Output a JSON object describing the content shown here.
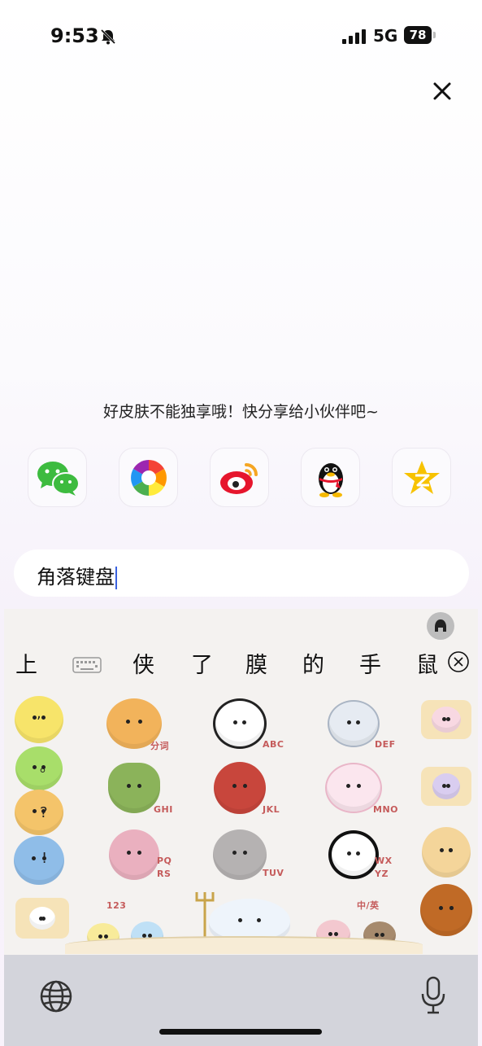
{
  "status_bar": {
    "time": "9:53",
    "network": "5G",
    "battery": "78"
  },
  "share": {
    "prompt": "好皮肤不能独享哦！快分享给小伙伴吧~",
    "targets": [
      {
        "name": "wechat",
        "icon": "wechat-icon"
      },
      {
        "name": "moments",
        "icon": "moments-aperture-icon"
      },
      {
        "name": "weibo",
        "icon": "weibo-icon"
      },
      {
        "name": "qq",
        "icon": "qq-penguin-icon"
      },
      {
        "name": "qzone",
        "icon": "qzone-star-icon"
      }
    ]
  },
  "input": {
    "value": "角落键盘"
  },
  "candidates": [
    "上",
    "侠",
    "了",
    "膜",
    "的",
    "手",
    "鼠"
  ],
  "keyboard": {
    "punct": [
      ",",
      "。",
      "?",
      "!"
    ],
    "keys": [
      {
        "label": "分词",
        "color": "#f2b35b"
      },
      {
        "label": "ABC",
        "color": "#ffffff"
      },
      {
        "label": "DEF",
        "color": "#e6ebf2"
      },
      {
        "label": "GHI",
        "color": "#8bb35a"
      },
      {
        "label": "JKL",
        "color": "#c8463c"
      },
      {
        "label": "MNO",
        "color": "#fbe6ee"
      },
      {
        "label": "PQ RS",
        "color": "#eab0bf"
      },
      {
        "label": "TUV",
        "color": "#b5b2b2"
      },
      {
        "label": "WX YZ",
        "color": "#ffffff"
      }
    ],
    "bottom_labels": {
      "numbers": "123",
      "lang": "中/英"
    },
    "side_colors": [
      "#f7e46a",
      "#a8de6a",
      "#f4c46a",
      "#8fbde8"
    ],
    "accent": "#c55b5b"
  }
}
